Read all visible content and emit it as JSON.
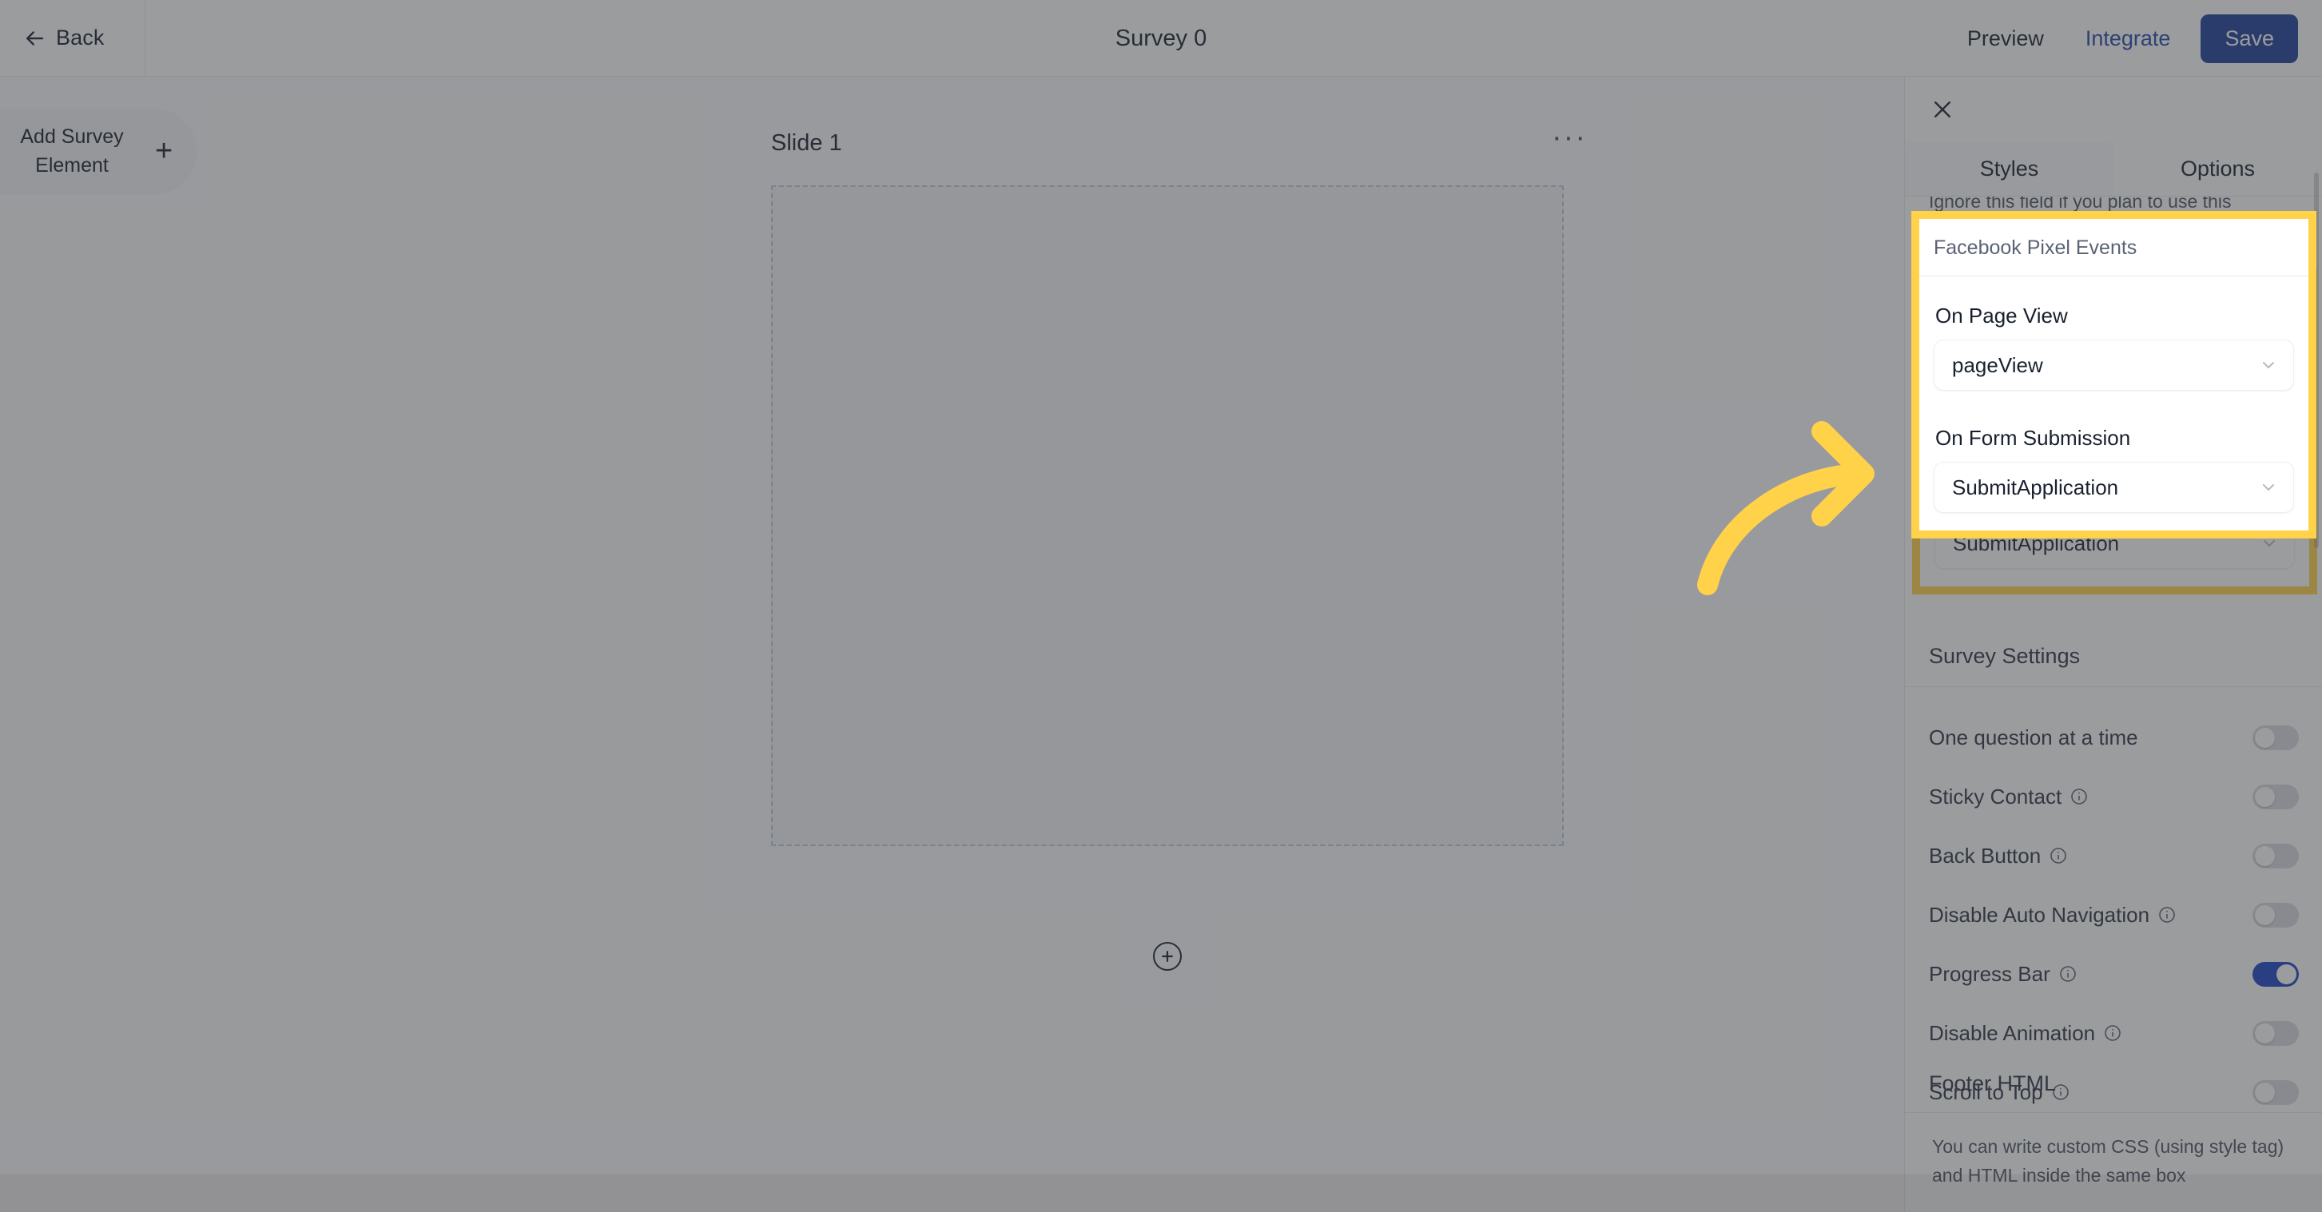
{
  "topbar": {
    "back_label": "Back",
    "back_icon": "arrow-left-icon",
    "title": "Survey 0",
    "preview_label": "Preview",
    "integrate_label": "Integrate",
    "save_label": "Save",
    "save_color": "#1c3f9b",
    "integrate_color": "#2348a8"
  },
  "workspace": {
    "add_element_line1": "Add Survey",
    "add_element_line2": "Element",
    "add_element_plus": "+",
    "slide_name": "Slide 1",
    "slide_menu": "···",
    "add_slide_icon": "plus-circle-icon"
  },
  "panel": {
    "close_icon": "close-icon",
    "tabs": [
      {
        "label": "Styles",
        "active": false
      },
      {
        "label": "Options",
        "active": true
      }
    ],
    "clipped_hint": "Ignore this field if you plan to use this form/survey inside a funnel",
    "highlight_color": "#ffd24a",
    "facebook_pixel": {
      "card_title": "Facebook Pixel Events",
      "fields": [
        {
          "label": "On Page View",
          "value": "pageView",
          "chevron": "chevron-down-icon"
        },
        {
          "label": "On Form Submission",
          "value": "SubmitApplication",
          "chevron": "chevron-down-icon"
        }
      ]
    },
    "survey_settings": {
      "title": "Survey Settings",
      "rows": [
        {
          "label": "One question at a time",
          "info": false,
          "on": false
        },
        {
          "label": "Sticky Contact",
          "info": true,
          "on": false
        },
        {
          "label": "Back Button",
          "info": true,
          "on": false
        },
        {
          "label": "Disable Auto Navigation",
          "info": true,
          "on": false
        },
        {
          "label": "Progress Bar",
          "info": true,
          "on": true
        },
        {
          "label": "Disable Animation",
          "info": true,
          "on": false
        },
        {
          "label": "Scroll to Top",
          "info": true,
          "on": false
        }
      ],
      "toggle_on_color": "#1c45c4",
      "toggle_off_color": "#d9dbe0"
    },
    "footer_html": {
      "title": "Footer HTML",
      "hint": "You can write custom CSS (using style tag) and HTML inside the same box"
    }
  },
  "annotation": {
    "arrow_icon": "curved-arrow-right-icon",
    "arrow_color": "#ffd24a"
  }
}
